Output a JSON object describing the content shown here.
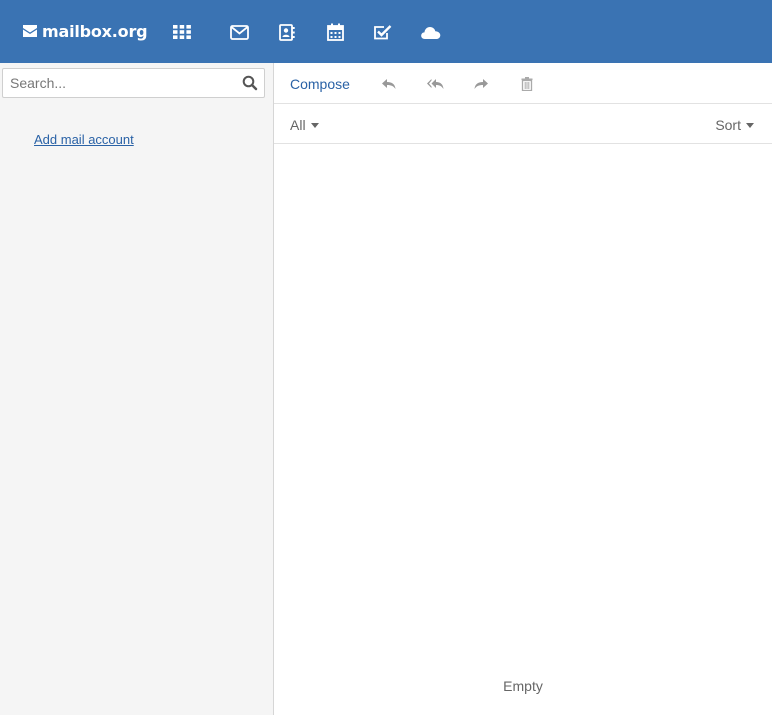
{
  "header": {
    "logo_text": "mailbox.org",
    "colors": {
      "bar": "#3a73b3",
      "icon": "#ffffff"
    },
    "apps": [
      {
        "name": "app-launcher",
        "icon": "grid-icon"
      },
      {
        "name": "mail",
        "icon": "envelope-icon"
      },
      {
        "name": "address-book",
        "icon": "address-book-icon"
      },
      {
        "name": "calendar",
        "icon": "calendar-icon"
      },
      {
        "name": "tasks",
        "icon": "check-square-icon"
      },
      {
        "name": "drive",
        "icon": "cloud-icon"
      }
    ]
  },
  "sidebar": {
    "search": {
      "value": "",
      "placeholder": "Search...",
      "icon": "search-icon"
    },
    "add_account_label": "Add mail account"
  },
  "toolbar": {
    "compose_label": "Compose",
    "actions": [
      {
        "name": "reply",
        "icon": "reply-icon"
      },
      {
        "name": "reply-all",
        "icon": "reply-all-icon"
      },
      {
        "name": "forward",
        "icon": "forward-icon"
      },
      {
        "name": "delete",
        "icon": "trash-icon"
      }
    ]
  },
  "list": {
    "filter_label": "All",
    "sort_label": "Sort",
    "empty_label": "Empty"
  }
}
